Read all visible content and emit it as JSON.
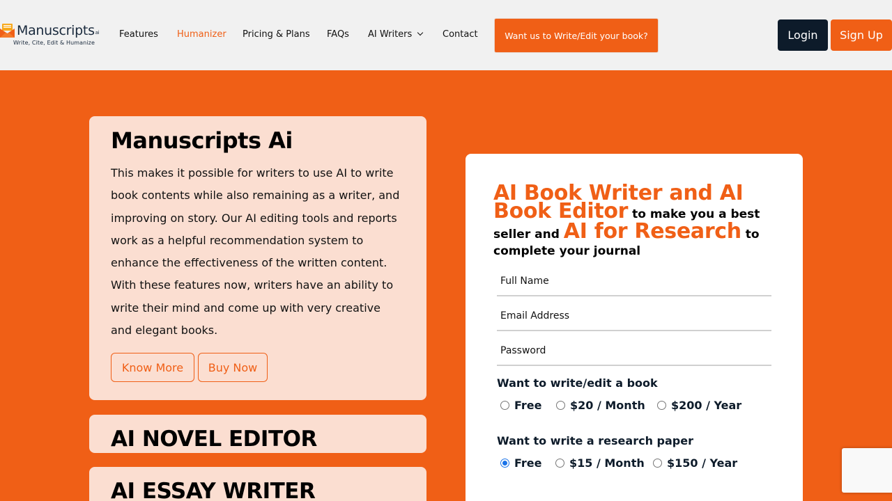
{
  "header": {
    "logo": {
      "name": "Manuscripts",
      "suffix": "ai",
      "tagline": "Write, Cite, Edit & Humanize"
    },
    "nav": {
      "features": "Features",
      "humanizer": "Humanizer",
      "pricing": "Pricing & Plans",
      "faqs": "FAQs",
      "ai_writers": "AI Writers",
      "contact": "Contact"
    },
    "cta_label": "Want us to Write/Edit your book?",
    "login_label": "Login",
    "signup_label": "Sign Up"
  },
  "cards": {
    "main": {
      "title": "Manuscripts Ai",
      "body": "This makes it possible for writers to use AI to write book contents while also remaining as a writer, and improving on story. Our AI editing tools and reports work as a helpful recommendation system to enhance the effectiveness of the written content. With these features now, writers have an ability to write their mind and come up with very creative and elegant books.",
      "know_more": "Know More",
      "buy_now": "Buy Now"
    },
    "novel_editor_title": "AI NOVEL EDITOR",
    "essay_writer_title": "AI ESSAY WRITER"
  },
  "form": {
    "headline": {
      "part1": "AI Book Writer and AI Book Editor",
      "part2": " to make you a best seller and ",
      "part3": "AI for Research",
      "part4": " to complete your journal"
    },
    "full_name_placeholder": "Full Name",
    "email_placeholder": "Email Address",
    "password_placeholder": "Password",
    "book_group": {
      "label": "Want to write/edit a book",
      "options": [
        "Free",
        "$20 / Month",
        "$200 / Year"
      ],
      "selected": ""
    },
    "research_group": {
      "label": "Want to write a research paper",
      "options": [
        "Free",
        "$15 / Month",
        "$150 / Year"
      ],
      "selected": "Free"
    }
  },
  "colors": {
    "brand_orange": "#f05f16",
    "navy": "#0d1b2a",
    "card_bg": "#fbded1",
    "header_bg": "#f1f1f1"
  }
}
